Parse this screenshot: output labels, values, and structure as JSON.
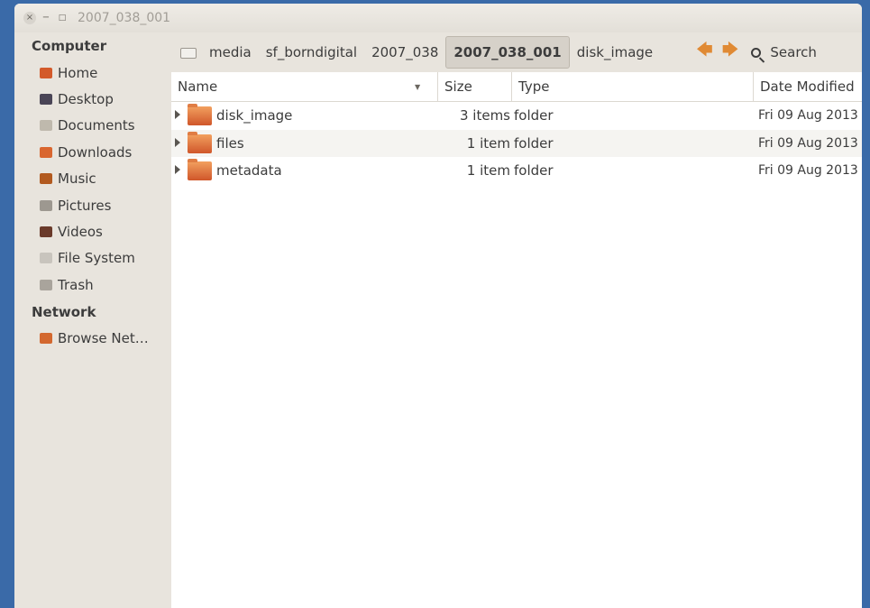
{
  "window": {
    "title": "2007_038_001",
    "close": "×",
    "minimize": "−",
    "maximize": "□"
  },
  "sidebar": {
    "computer_heading": "Computer",
    "items": [
      {
        "label": "Home",
        "icon": "home-icon",
        "color": "#d35a2a"
      },
      {
        "label": "Desktop",
        "icon": "desktop-icon",
        "color": "#4a4556"
      },
      {
        "label": "Documents",
        "icon": "documents-icon",
        "color": "#bfb9ad"
      },
      {
        "label": "Downloads",
        "icon": "downloads-icon",
        "color": "#d9662f"
      },
      {
        "label": "Music",
        "icon": "music-icon",
        "color": "#b25a1f"
      },
      {
        "label": "Pictures",
        "icon": "pictures-icon",
        "color": "#9d9890"
      },
      {
        "label": "Videos",
        "icon": "videos-icon",
        "color": "#6a3a2a"
      },
      {
        "label": "File System",
        "icon": "filesystem-icon",
        "color": "#c8c4bd"
      },
      {
        "label": "Trash",
        "icon": "trash-icon",
        "color": "#a9a49c"
      }
    ],
    "network_heading": "Network",
    "network_items": [
      {
        "label": "Browse Net…",
        "icon": "browse-network-icon",
        "color": "#d3682f"
      }
    ]
  },
  "pathbar": {
    "crumbs": [
      "media",
      "sf_borndigital",
      "2007_038",
      "2007_038_001",
      "disk_image"
    ],
    "active_index": 3,
    "search_label": "Search"
  },
  "columns": {
    "name": "Name",
    "size": "Size",
    "type": "Type",
    "date": "Date Modified"
  },
  "files": [
    {
      "name": "disk_image",
      "size": "3 items",
      "type": "folder",
      "date": "Fri 09 Aug 2013"
    },
    {
      "name": "files",
      "size": "1 item",
      "type": "folder",
      "date": "Fri 09 Aug 2013"
    },
    {
      "name": "metadata",
      "size": "1 item",
      "type": "folder",
      "date": "Fri 09 Aug 2013"
    }
  ],
  "colors": {
    "desktop_bg": "#3a6aa8",
    "sidebar_bg": "#e8e4dd",
    "accent_arrow": "#e08a34"
  }
}
